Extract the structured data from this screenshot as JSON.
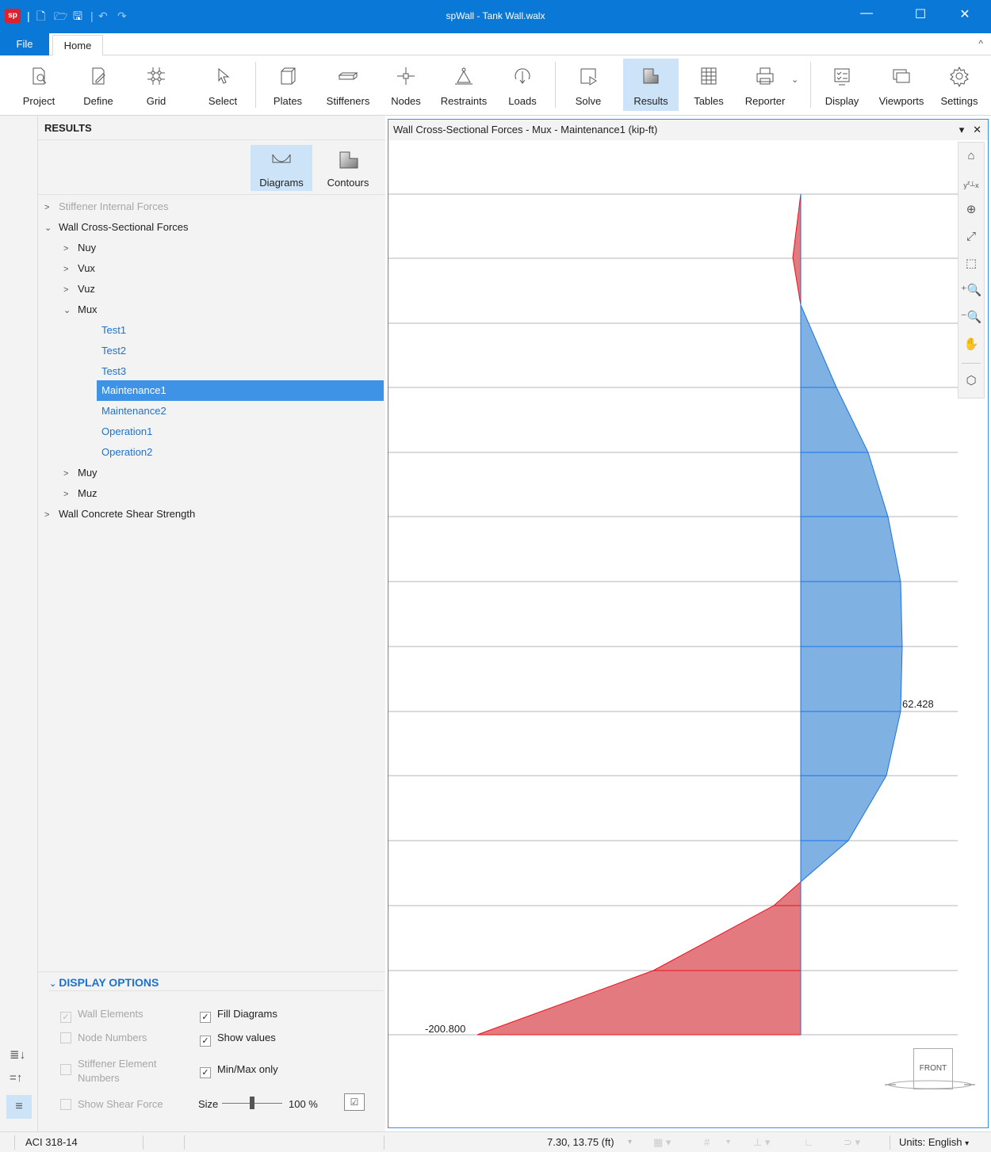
{
  "window": {
    "title": "spWall - Tank Wall.walx",
    "app_badge": "sp",
    "minimize": "—",
    "maximize": "☐",
    "close": "✕"
  },
  "tabs": {
    "file": "File",
    "home": "Home"
  },
  "ribbon": {
    "items": [
      {
        "label": "Project",
        "icon": "project-icon"
      },
      {
        "label": "Define",
        "icon": "define-icon"
      },
      {
        "label": "Grid",
        "icon": "grid-icon"
      },
      {
        "label": "Select",
        "icon": "select-icon"
      },
      {
        "label": "Plates",
        "icon": "plates-icon"
      },
      {
        "label": "Stiffeners",
        "icon": "stiffeners-icon"
      },
      {
        "label": "Nodes",
        "icon": "nodes-icon"
      },
      {
        "label": "Restraints",
        "icon": "restraints-icon"
      },
      {
        "label": "Loads",
        "icon": "loads-icon"
      },
      {
        "label": "Solve",
        "icon": "solve-icon"
      },
      {
        "label": "Results",
        "icon": "results-icon",
        "active": true
      },
      {
        "label": "Tables",
        "icon": "tables-icon"
      },
      {
        "label": "Reporter",
        "icon": "reporter-icon"
      },
      {
        "label": "Display",
        "icon": "display-icon"
      },
      {
        "label": "Viewports",
        "icon": "viewports-icon"
      },
      {
        "label": "Settings",
        "icon": "settings-icon"
      }
    ]
  },
  "panel": {
    "title": "RESULTS",
    "modes": {
      "diagrams": "Diagrams",
      "contours": "Contours"
    },
    "tree": {
      "stiffener": "Stiffener Internal Forces",
      "wall_cs": "Wall Cross-Sectional Forces",
      "nuy": "Nuy",
      "vux": "Vux",
      "vuz": "Vuz",
      "mux": "Mux",
      "cases": [
        "Test1",
        "Test2",
        "Test3",
        "Maintenance1",
        "Maintenance2",
        "Operation1",
        "Operation2"
      ],
      "muy": "Muy",
      "muz": "Muz",
      "shear": "Wall Concrete Shear Strength"
    },
    "display_options": {
      "title": "DISPLAY OPTIONS",
      "wall_elements": "Wall Elements",
      "node_numbers": "Node Numbers",
      "stiffener_numbers_1": "Stiffener Element",
      "stiffener_numbers_2": "Numbers",
      "show_shear": "Show Shear Force",
      "fill_diagrams": "Fill Diagrams",
      "show_values": "Show values",
      "minmax": "Min/Max only",
      "size_label": "Size",
      "size_value": "100 %",
      "size_fraction": 0.5
    }
  },
  "viewport": {
    "title": "Wall Cross-Sectional Forces - Mux - Maintenance1 (kip-ft)",
    "pin": "▾",
    "close": "✕",
    "max_label": "62.428",
    "min_label": "-200.800",
    "front_label": "FRONT",
    "axes": {
      "x": "x",
      "y": "y",
      "z": "z"
    }
  },
  "status": {
    "code": "ACI 318-14",
    "coords": "7.30, 13.75 (ft)",
    "units_label": "Units:",
    "units_value": "English"
  },
  "colors": {
    "accent": "#0a78d7",
    "positive_fill": "#7fb1e3",
    "positive_line": "#1a73e8",
    "negative_fill": "#e37a80",
    "negative_line": "#e8121d",
    "selection": "#3f93e6"
  }
}
